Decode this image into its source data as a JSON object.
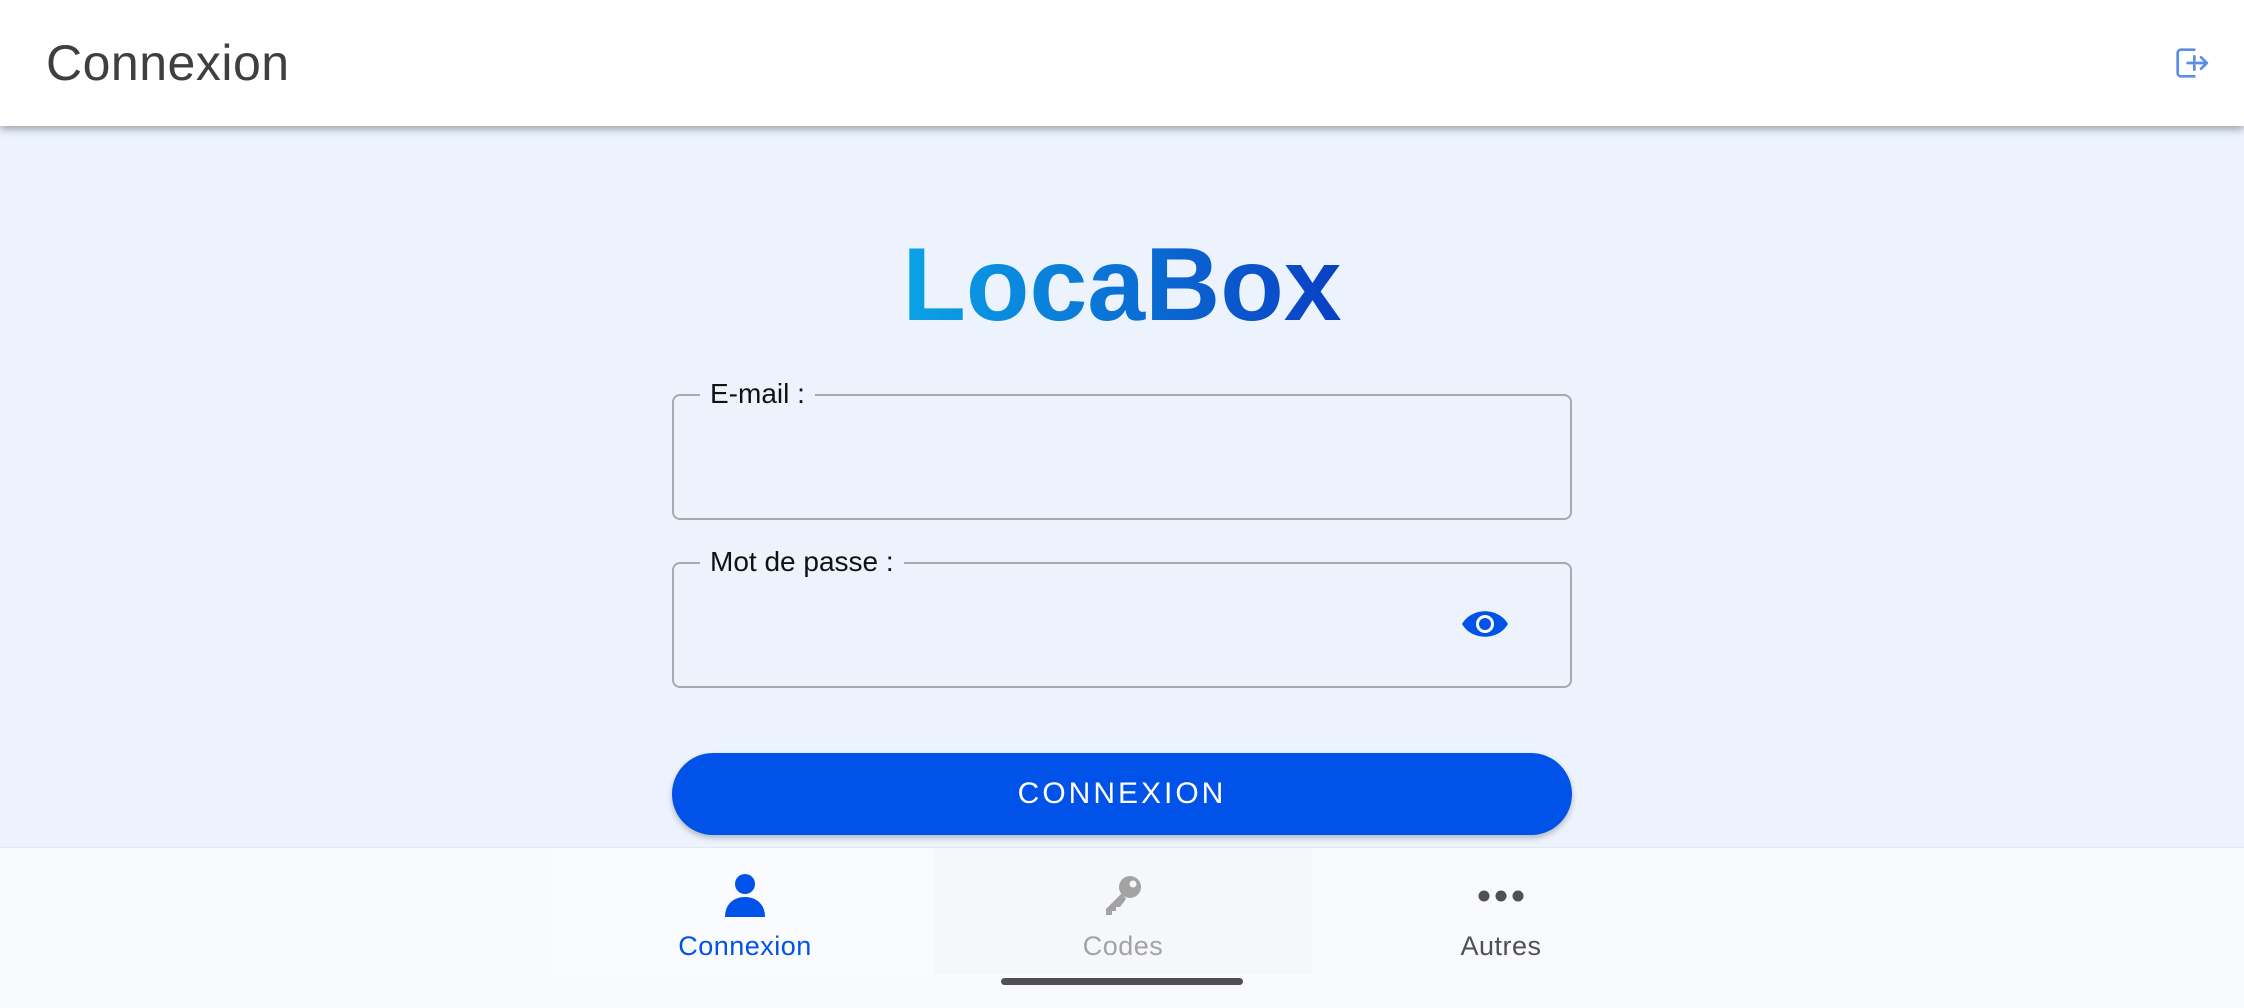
{
  "app_bar": {
    "title": "Connexion",
    "logout_icon": "logout-icon"
  },
  "logo": {
    "text": "LocaBox",
    "gradient_start": "#0aa3e6",
    "gradient_end": "#0a3fc4"
  },
  "form": {
    "email": {
      "label": "E-mail :",
      "value": ""
    },
    "password": {
      "label": "Mot de passe :",
      "value": "",
      "toggle_icon": "eye-icon"
    },
    "submit_label": "CONNEXION"
  },
  "bottom_nav": {
    "items": [
      {
        "label": "Connexion",
        "icon": "person-icon",
        "active": true
      },
      {
        "label": "Codes",
        "icon": "key-icon",
        "active": false
      },
      {
        "label": "Autres",
        "icon": "more-horizontal-icon",
        "active": false
      }
    ]
  },
  "colors": {
    "accent": "#0052e8",
    "background": "#ecf3fd",
    "app_bar_title": "#3f3f3f",
    "inactive_nav": "#a3a3a3"
  }
}
